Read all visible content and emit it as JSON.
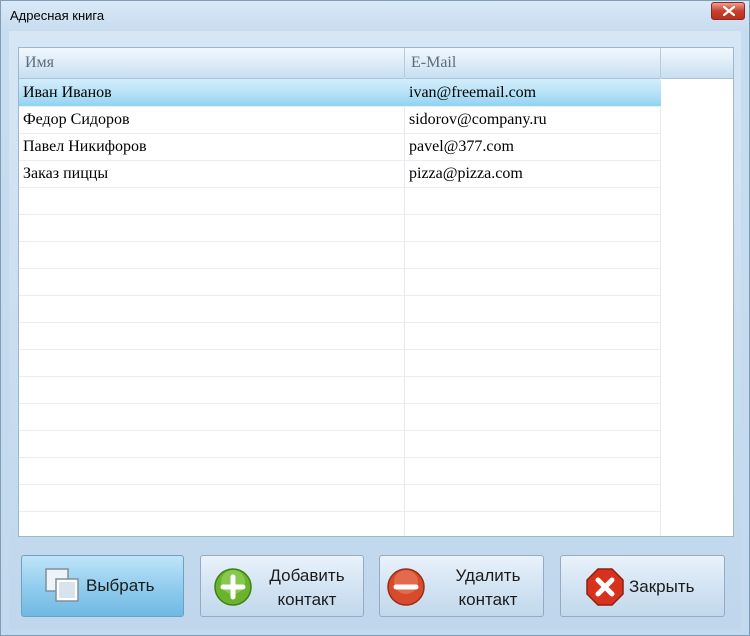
{
  "window": {
    "title": "Адресная книга"
  },
  "grid": {
    "columns": [
      "Имя",
      "E-Mail"
    ],
    "rows": [
      {
        "name": "Иван Иванов",
        "email": "ivan@freemail.com",
        "selected": true
      },
      {
        "name": "Федор Сидоров",
        "email": "sidorov@company.ru",
        "selected": false
      },
      {
        "name": "Павел Никифоров",
        "email": "pavel@377.com",
        "selected": false
      },
      {
        "name": "Заказ пиццы",
        "email": "pizza@pizza.com",
        "selected": false
      }
    ]
  },
  "buttons": {
    "select": "Выбрать",
    "add_line1": "Добавить",
    "add_line2": "контакт",
    "delete_line1": "Удалить",
    "delete_line2": "контакт",
    "close": "Закрыть"
  },
  "icons": {
    "select": "select-icon",
    "add": "add-icon",
    "delete": "delete-icon",
    "close": "close-icon"
  },
  "colors": {
    "add": "#6ab42d",
    "delete": "#d84a2c",
    "close": "#d8321e",
    "selection": "#8fd3f2"
  }
}
